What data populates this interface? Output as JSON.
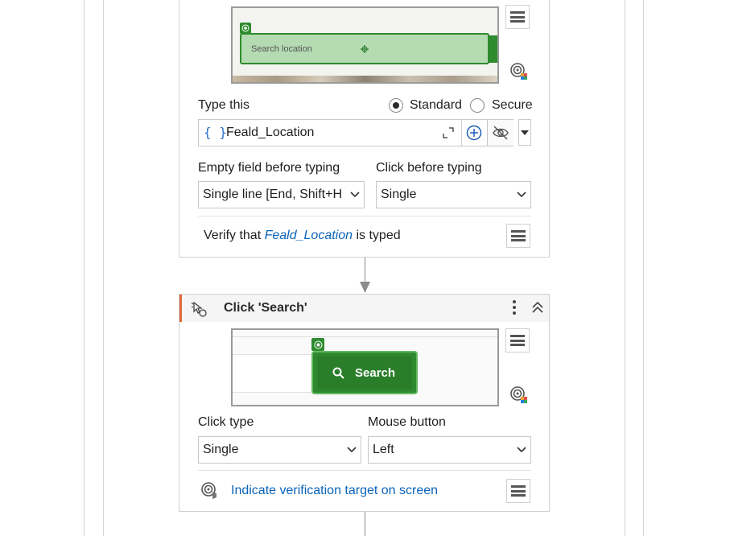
{
  "type_activity": {
    "preview_placeholder": "Search location",
    "type_this_label": "Type this",
    "mode_standard": "Standard",
    "mode_secure": "Secure",
    "input_brace": "{ }",
    "input_value": "Feald_Location",
    "empty_field_label": "Empty field before typing",
    "empty_field_value": "Single line [End, Shift+H",
    "click_before_label": "Click before typing",
    "click_before_value": "Single",
    "verify_prefix": "Verify that",
    "verify_var": "Feald_Location",
    "verify_suffix": "is typed"
  },
  "click_activity": {
    "title": "Click 'Search'",
    "preview_button": "Search",
    "click_type_label": "Click type",
    "click_type_value": "Single",
    "mouse_button_label": "Mouse button",
    "mouse_button_value": "Left",
    "indicate_link": "Indicate verification target on screen"
  },
  "colors": {
    "accent_orange": "#e06a3a",
    "link_blue": "#0a63b8",
    "target_green": "#2e8b2e"
  }
}
